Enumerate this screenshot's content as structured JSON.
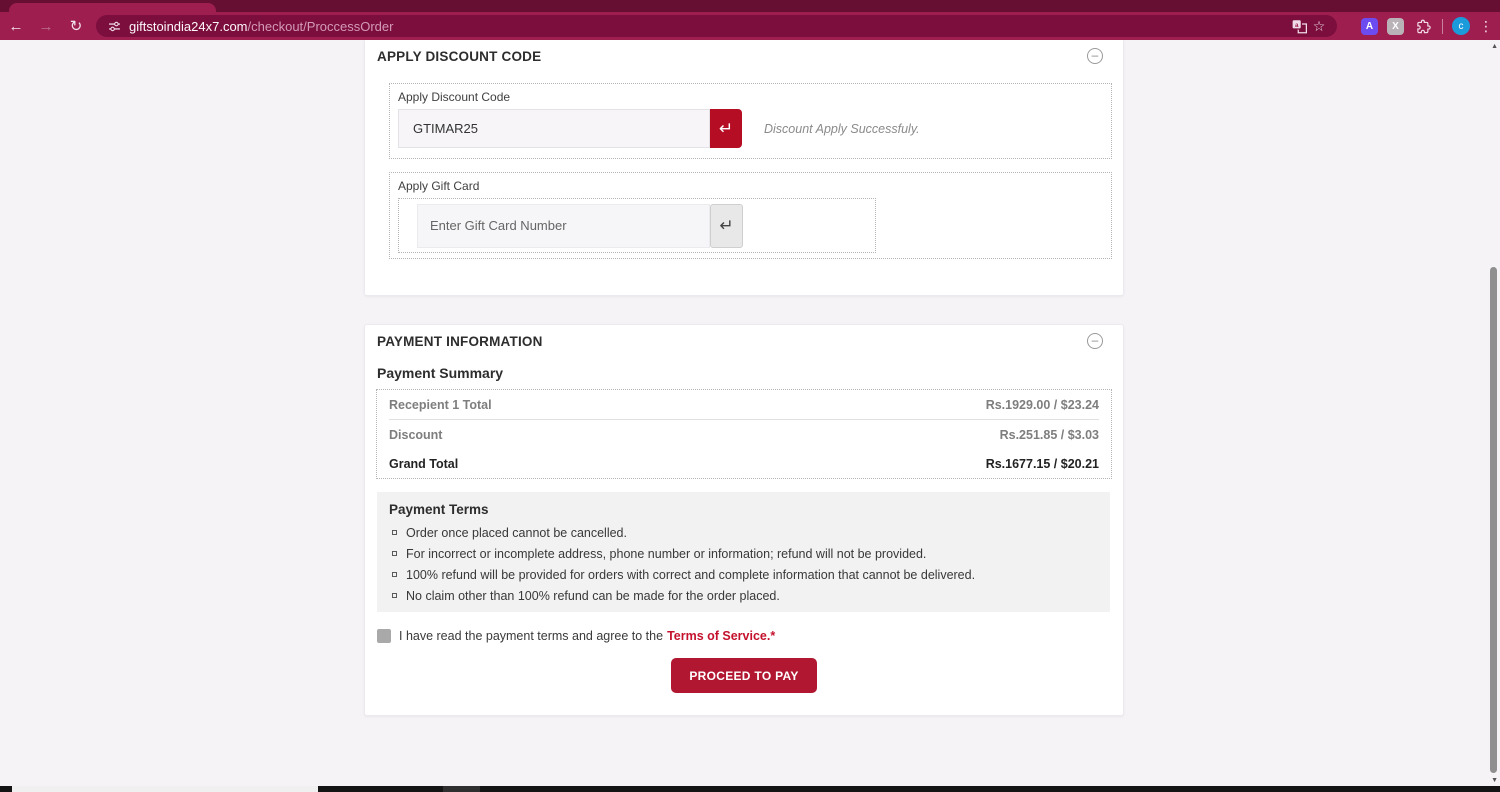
{
  "colors": {
    "frame": "#670f33",
    "toolbar": "#9e1e50",
    "omnibox": "#7b0e3c",
    "accent_red_button": "#b11730",
    "enter_button_red": "#b50d23",
    "link_red": "#c4122d",
    "page_background": "#f5f3f6"
  },
  "browser": {
    "url_domain": "giftstoindia24x7.com",
    "url_path": "/checkout/ProccessOrder",
    "extension_a_label": "A",
    "extension_x_label": "X",
    "avatar_letter": "c"
  },
  "icons": {
    "back": "←",
    "forward": "→",
    "reload": "↻",
    "star": "☆",
    "kebab": "⋮",
    "enter": "↵",
    "collapse": "–",
    "scroll_up": "▲",
    "scroll_down": "▼"
  },
  "discount": {
    "title": "APPLY DISCOUNT CODE",
    "code_label": "Apply Discount Code",
    "code_value": "GTIMAR25",
    "success_message": "Discount Apply Successfuly.",
    "gift_label": "Apply Gift Card",
    "gift_placeholder": "Enter Gift Card Number"
  },
  "payment": {
    "title": "PAYMENT INFORMATION",
    "summary_title": "Payment Summary",
    "rows": [
      {
        "label": "Recepient 1 Total",
        "value": "Rs.1929.00 / $23.24"
      },
      {
        "label": "Discount",
        "value": "Rs.251.85 / $3.03"
      },
      {
        "label": "Grand Total",
        "value": "Rs.1677.15 / $20.21"
      }
    ],
    "terms_title": "Payment Terms",
    "terms": [
      "Order once placed cannot be cancelled.",
      "For incorrect or incomplete address, phone number or information; refund will not be provided.",
      "100% refund will be provided for orders with correct and complete information that cannot be delivered.",
      "No claim other than 100% refund can be made for the order placed."
    ],
    "agree_text": "I have read the payment terms and agree to the",
    "tos_link": "Terms of Service.*",
    "pay_button": "PROCEED TO PAY"
  }
}
